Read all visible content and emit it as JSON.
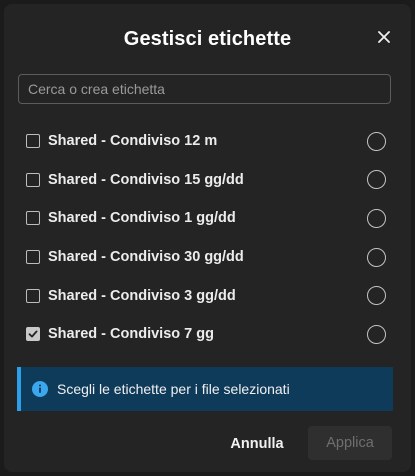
{
  "dialog": {
    "title": "Gestisci etichette",
    "close_icon": "close-icon"
  },
  "search": {
    "placeholder": "Cerca o crea etichetta",
    "value": ""
  },
  "labels": [
    {
      "text": "Shared - Condiviso 12 m",
      "checked": false
    },
    {
      "text": "Shared - Condiviso 15 gg/dd",
      "checked": false
    },
    {
      "text": "Shared - Condiviso 1 gg/dd",
      "checked": false
    },
    {
      "text": "Shared - Condiviso 30 gg/dd",
      "checked": false
    },
    {
      "text": "Shared - Condiviso 3 gg/dd",
      "checked": false
    },
    {
      "text": "Shared - Condiviso 7 gg",
      "checked": true
    }
  ],
  "info": {
    "icon": "info-icon",
    "text": "Scegli le etichette per i file selezionati"
  },
  "footer": {
    "cancel_label": "Annulla",
    "apply_label": "Applica",
    "apply_enabled": false
  },
  "colors": {
    "dialog_bg": "#242424",
    "info_bg": "#0f3b5b",
    "info_accent": "#2f9ee8"
  }
}
